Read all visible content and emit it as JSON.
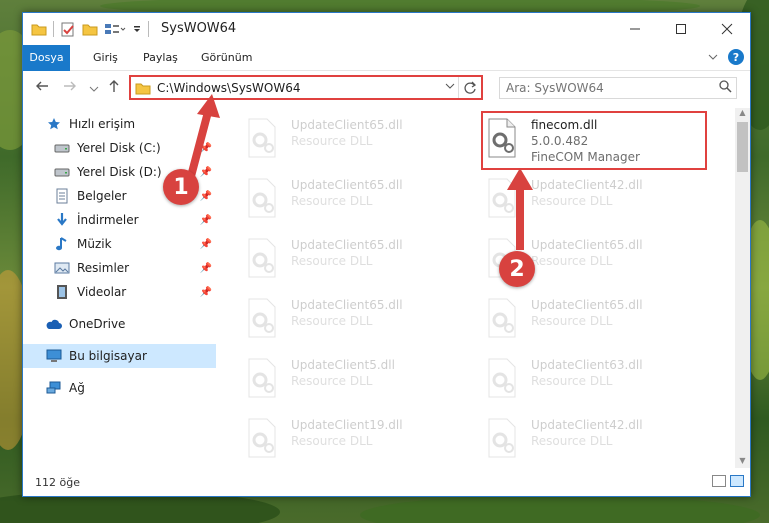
{
  "window": {
    "title": "SysWOW64"
  },
  "ribbon": {
    "tabs": [
      "Dosya",
      "Giriş",
      "Paylaş",
      "Görünüm"
    ],
    "help_label": "?"
  },
  "navigation": {
    "address": "C:\\Windows\\SysWOW64",
    "search_placeholder": "Ara: SysWOW64"
  },
  "sidebar": {
    "items": [
      {
        "label": "Hızlı erişim",
        "icon": "star-icon"
      },
      {
        "label": "Yerel Disk (C:)",
        "icon": "drive-icon",
        "pinned": true
      },
      {
        "label": "Yerel Disk (D:)",
        "icon": "drive-icon",
        "pinned": true
      },
      {
        "label": "Belgeler",
        "icon": "documents-icon",
        "pinned": true
      },
      {
        "label": "İndirmeler",
        "icon": "download-icon",
        "pinned": true
      },
      {
        "label": "Müzik",
        "icon": "music-icon",
        "pinned": true
      },
      {
        "label": "Resimler",
        "icon": "pictures-icon",
        "pinned": true
      },
      {
        "label": "Videolar",
        "icon": "videos-icon",
        "pinned": true
      },
      {
        "label": "OneDrive",
        "icon": "cloud-icon"
      },
      {
        "label": "Bu bilgisayar",
        "icon": "computer-icon",
        "selected": true
      },
      {
        "label": "Ağ",
        "icon": "network-icon"
      }
    ]
  },
  "files": {
    "left": [
      {
        "name": "UpdateClient65.dll",
        "type": "Resource DLL"
      },
      {
        "name": "UpdateClient65.dll",
        "type": "Resource DLL"
      },
      {
        "name": "UpdateClient65.dll",
        "type": "Resource DLL"
      },
      {
        "name": "UpdateClient65.dll",
        "type": "Resource DLL"
      },
      {
        "name": "UpdateClient5.dll",
        "type": "Resource DLL"
      },
      {
        "name": "UpdateClient19.dll",
        "type": "Resource DLL"
      }
    ],
    "highlighted": {
      "name": "finecom.dll",
      "version": "5.0.0.482",
      "company": "FineCOM Manager"
    },
    "right": [
      {
        "name": "UpdateClient42.dll",
        "type": "Resource DLL"
      },
      {
        "name": "UpdateClient65.dll",
        "type": "Resource DLL"
      },
      {
        "name": "UpdateClient65.dll",
        "type": "Resource DLL"
      },
      {
        "name": "UpdateClient63.dll",
        "type": "Resource DLL"
      },
      {
        "name": "UpdateClient42.dll",
        "type": "Resource DLL"
      }
    ]
  },
  "status": {
    "item_count": "112 öğe"
  },
  "annotations": {
    "step1": "1",
    "step2": "2",
    "color": "#d8423f"
  }
}
